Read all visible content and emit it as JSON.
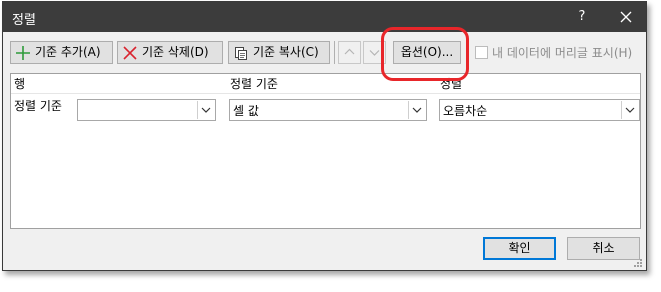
{
  "window": {
    "title": "정렬",
    "help_label": "?",
    "close_icon": "close-icon"
  },
  "toolbar": {
    "add_label": "기준 추가(A)",
    "add_icon": "plus-icon",
    "delete_label": "기준 삭제(D)",
    "delete_icon": "x-icon",
    "copy_label": "기준 복사(C)",
    "copy_icon": "copy-icon",
    "move_up_icon": "arrow-up-icon",
    "move_down_icon": "arrow-down-icon",
    "options_label": "옵션(O)...",
    "header_checkbox_label": "내 데이터에 머리글 표시(H)",
    "header_checkbox_checked": false
  },
  "grid": {
    "headers": {
      "column": "행",
      "sort_on": "정렬 기준",
      "order": "정렬"
    },
    "row": {
      "label": "정렬 기준",
      "column_value": "",
      "sort_on_value": "셀 값",
      "order_value": "오름차순"
    }
  },
  "footer": {
    "ok_label": "확인",
    "cancel_label": "취소"
  },
  "colors": {
    "titlebar": "#3c3c3c",
    "highlight": "#e8262a",
    "primary_border": "#0078d7",
    "plus_green": "#2e9b3a",
    "delete_red": "#d9232e"
  }
}
